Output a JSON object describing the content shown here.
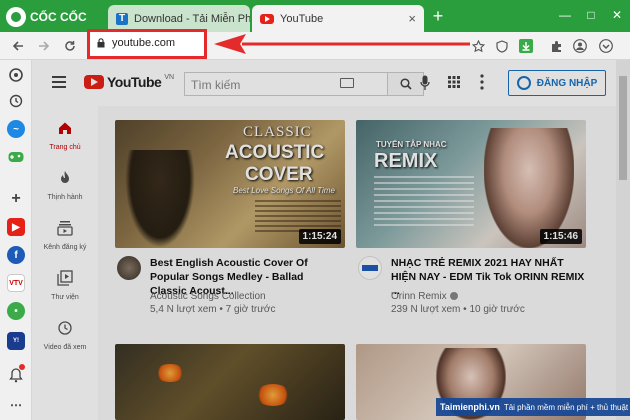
{
  "browser": {
    "brand": "CỐC CỐC",
    "tabs": [
      {
        "title": "Download - Tải Miễn Phí VN",
        "close": "×"
      },
      {
        "title": "YouTube",
        "close": "×"
      }
    ],
    "new_tab": "+",
    "window_controls": [
      "—",
      "□",
      "✕"
    ],
    "address": "youtube.com"
  },
  "youtube": {
    "logo_text": "YouTube",
    "logo_region": "VN",
    "search_placeholder": "Tìm kiếm",
    "sign_in_label": "ĐĂNG NHẬP",
    "guide": [
      {
        "label": "Trang chủ"
      },
      {
        "label": "Thịnh hành"
      },
      {
        "label": "Kênh đăng ký"
      },
      {
        "label": "Thư viện"
      },
      {
        "label": "Video đã xem"
      }
    ],
    "videos": [
      {
        "thumb_line1": "CLASSIC",
        "thumb_line2": "ACOUSTIC",
        "thumb_line3": "COVER",
        "thumb_sub": "Best Love Songs Of All Time",
        "duration": "1:15:24",
        "title": "Best English Acoustic Cover Of Popular Songs Medley - Ballad Classic Acoust...",
        "channel": "Acoustic Songs Collection",
        "meta": "5,4 N lượt xem • 7 giờ trước"
      },
      {
        "thumb_line1": "TUYỂN TẬP NHẠC",
        "thumb_line2": "REMIX",
        "duration": "1:15:46",
        "title": "NHẠC TRẺ REMIX 2021 HAY NHẤT HIỆN NAY - EDM Tik Tok ORINN REMIX ...",
        "channel": "Orinn Remix",
        "meta": "239 N lượt xem • 10 giờ trước"
      }
    ]
  },
  "watermark": {
    "site": "Taimienphi.vn",
    "slogan": "Tải phần mềm miễn phí + thủ thuật hay"
  },
  "colors": {
    "tabstrip": "#2a9d3d",
    "highlight": "#e42a2a",
    "youtube_red": "#e62117",
    "link_blue": "#1a73c4"
  }
}
